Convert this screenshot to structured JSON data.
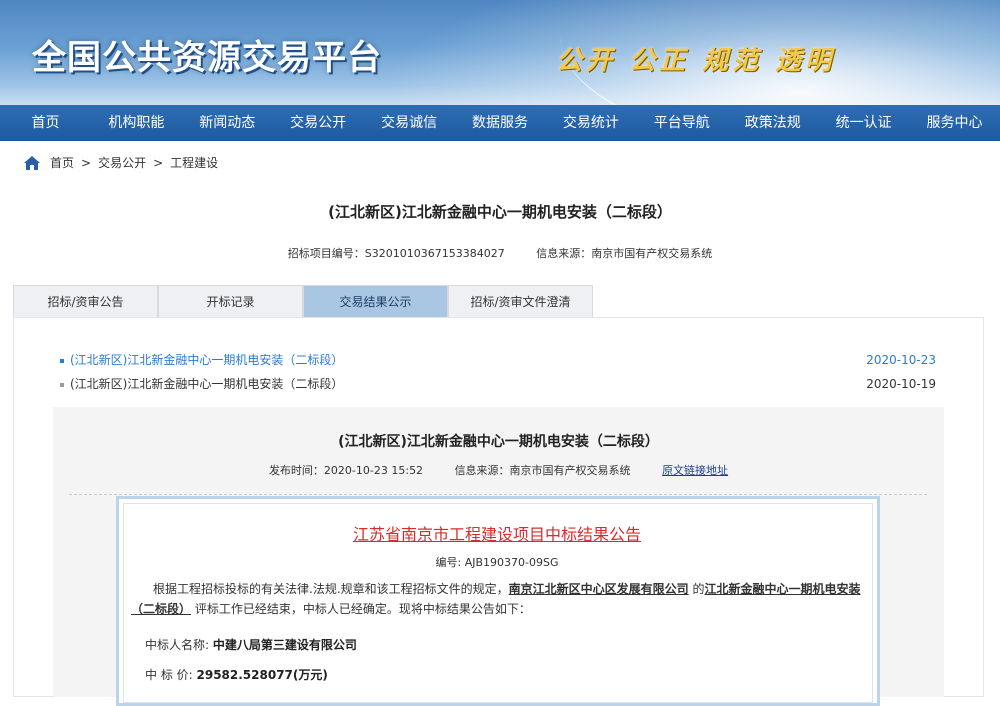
{
  "banner": {
    "site_title": "全国公共资源交易平台",
    "slogan": "公开 公正 规范 透明"
  },
  "nav": {
    "items": [
      "首页",
      "机构职能",
      "新闻动态",
      "交易公开",
      "交易诚信",
      "数据服务",
      "交易统计",
      "平台导航",
      "政策法规",
      "统一认证",
      "服务中心"
    ]
  },
  "breadcrumb": {
    "items": [
      "首页",
      "交易公开",
      "工程建设"
    ],
    "separator": ">"
  },
  "project": {
    "title": "(江北新区)江北新金融中心一期机电安装（二标段）",
    "code": "招标项目编号：S3201010367153384027",
    "source": "信息来源：南京市国有产权交易系统"
  },
  "tabs": [
    "招标/资审公告",
    "开标记录",
    "交易结果公示",
    "招标/资审文件澄清"
  ],
  "list": [
    {
      "title": "(江北新区)江北新金融中心一期机电安装（二标段）",
      "date": "2020-10-23"
    },
    {
      "title": "(江北新区)江北新金融中心一期机电安装（二标段）",
      "date": "2020-10-19"
    }
  ],
  "detail": {
    "title": "(江北新区)江北新金融中心一期机电安装（二标段）",
    "publish_time": "发布时间：2020-10-23 15:52",
    "source": "信息来源：南京市国有产权交易系统",
    "original_link": "原文链接地址"
  },
  "document": {
    "title": "江苏省南京市工程建设项目中标结果公告",
    "number": "编号: AJB190370-09SG",
    "para_prefix": "根据工程招标投标的有关法律.法规.规章和该工程招标文件的规定，",
    "tenderer": "南京江北新区中心区发展有限公司",
    "mid": " 的",
    "project": "江北新金融中心一期机电安装（二标段）",
    "para_suffix": " 评标工作已经结束，中标人已经确定。现将中标结果公告如下：",
    "winner_label": "中标人名称: ",
    "winner": "中建八局第三建设有限公司",
    "price_label": "中 标 价: ",
    "price": "29582.528077(万元)"
  },
  "colors": {
    "nav_bg": "#1e5aa0",
    "tab_active": "#a9c7e3",
    "link_blue": "#2a7bd4",
    "doc_title_red": "#d92b2b"
  }
}
